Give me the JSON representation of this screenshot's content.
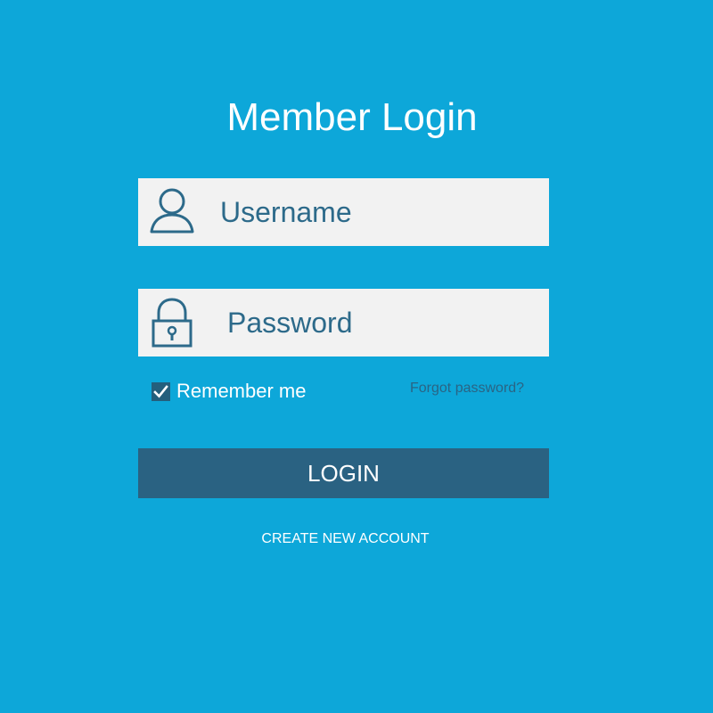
{
  "page": {
    "title": "Member Login"
  },
  "form": {
    "username_placeholder": "Username",
    "password_placeholder": "Password",
    "remember_label": "Remember me",
    "remember_checked": true,
    "forgot_label": "Forgot password?",
    "login_label": "LOGIN",
    "create_account_label": "CREATE NEW ACCOUNT"
  },
  "icons": {
    "username": "user-icon",
    "password": "lock-icon",
    "remember": "checkmark-icon"
  },
  "colors": {
    "background": "#0da7d9",
    "field_background": "#f2f2f2",
    "field_text": "#2d6a8a",
    "button_background": "#2a6282",
    "text_light": "#ffffff"
  }
}
